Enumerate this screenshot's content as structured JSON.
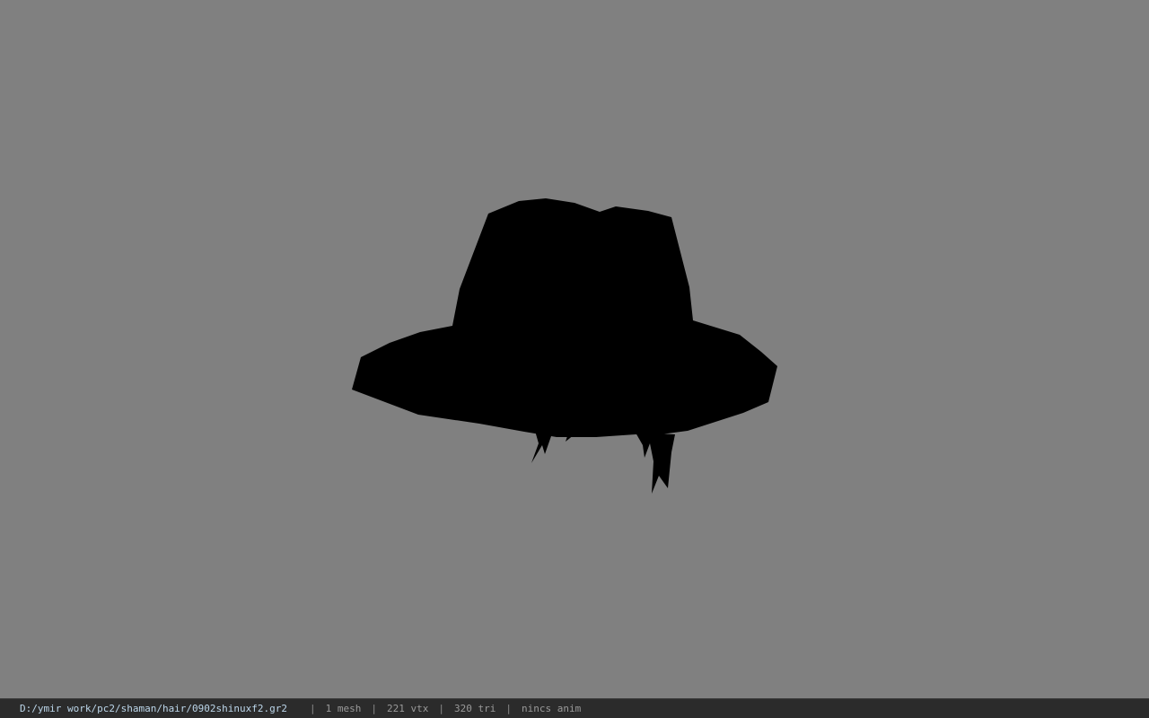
{
  "viewport": {
    "background": "#808080",
    "model_color": "#000000"
  },
  "status_bar": {
    "path": "D:/ymir work/pc2/shaman/hair/0902shinuxf2.gr2",
    "separator": "|",
    "mesh_count": "1 mesh",
    "vertex_count": "221 vtx",
    "triangle_count": "320 tri",
    "anim_status": "nincs anim"
  }
}
